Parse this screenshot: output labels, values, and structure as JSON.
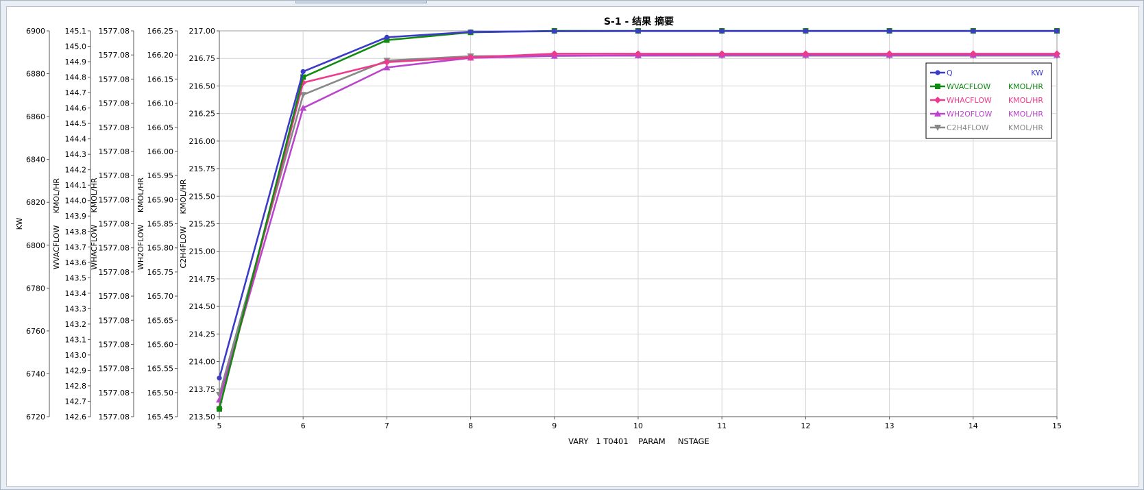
{
  "chart_data": {
    "type": "line",
    "title": "S-1 - 结果 摘要",
    "xlabel": "VARY   1 T0401    PARAM     NSTAGE",
    "x": [
      5,
      6,
      7,
      8,
      9,
      10,
      11,
      12,
      13,
      14,
      15
    ],
    "xlim": [
      5,
      15
    ],
    "grid": true,
    "legend_position": "top-right",
    "axes": [
      {
        "id": "q",
        "label": "KW",
        "ylim": [
          6720,
          6900
        ],
        "ticks": [
          "6720",
          "6740",
          "6760",
          "6780",
          "6800",
          "6820",
          "6840",
          "6860",
          "6880",
          "6900"
        ]
      },
      {
        "id": "wvac",
        "label": "WVACFLOW     KMOL/HR",
        "ylim": [
          142.6,
          145.1
        ],
        "ticks": [
          "142.6",
          "142.7",
          "142.8",
          "142.9",
          "143.0",
          "143.1",
          "143.2",
          "143.3",
          "143.4",
          "143.5",
          "143.6",
          "143.7",
          "143.8",
          "143.9",
          "144.0",
          "144.1",
          "144.2",
          "144.3",
          "144.4",
          "144.5",
          "144.6",
          "144.7",
          "144.8",
          "144.9",
          "145.0",
          "145.1"
        ]
      },
      {
        "id": "whac",
        "label": "WHACFLOW     KMOL/HR",
        "ylim": [
          0,
          16
        ],
        "ticks": [
          "1577.08",
          "1577.08",
          "1577.08",
          "1577.08",
          "1577.08",
          "1577.08",
          "1577.08",
          "1577.08",
          "1577.08",
          "1577.08",
          "1577.08",
          "1577.08",
          "1577.08",
          "1577.08",
          "1577.08",
          "1577.08",
          "1577.08"
        ]
      },
      {
        "id": "wh2o",
        "label": "WH2OFLOW     KMOL/HR",
        "ylim": [
          165.45,
          166.25
        ],
        "ticks": [
          "165.45",
          "165.50",
          "165.55",
          "165.60",
          "165.65",
          "165.70",
          "165.75",
          "165.80",
          "165.85",
          "165.90",
          "165.95",
          "166.00",
          "166.05",
          "166.10",
          "166.15",
          "166.20",
          "166.25"
        ]
      },
      {
        "id": "c2h4",
        "label": "C2H4FLOW     KMOL/HR",
        "ylim": [
          213.5,
          217.0
        ],
        "ticks": [
          "213.50",
          "213.75",
          "214.00",
          "214.25",
          "214.50",
          "214.75",
          "215.00",
          "215.25",
          "215.50",
          "215.75",
          "216.00",
          "216.25",
          "216.50",
          "216.75",
          "217.00"
        ]
      }
    ],
    "series": [
      {
        "name": "Q",
        "unit": "KW",
        "axis": "q",
        "color": "#3b3bc8",
        "marker": "circle",
        "values": [
          6738,
          6881,
          6897,
          6899.5,
          6899.8,
          6899.9,
          6899.9,
          6899.9,
          6899.9,
          6899.9,
          6899.9
        ]
      },
      {
        "name": "WVACFLOW",
        "unit": "KMOL/HR",
        "axis": "wvac",
        "color": "#118a11",
        "marker": "square",
        "values": [
          142.65,
          144.8,
          145.04,
          145.09,
          145.1,
          145.1,
          145.1,
          145.1,
          145.1,
          145.1,
          145.1
        ]
      },
      {
        "name": "WHACFLOW",
        "unit": "KMOL/HR",
        "axis": "whac",
        "color": "#ee3a8c",
        "marker": "diamond",
        "values": [
          0.35,
          13.85,
          14.7,
          14.9,
          15.05,
          15.05,
          15.05,
          15.05,
          15.05,
          15.05,
          15.05
        ]
      },
      {
        "name": "WH2OFLOW",
        "unit": "KMOL/HR",
        "axis": "wh2o",
        "color": "#bb44cc",
        "marker": "triangle-up",
        "values": [
          165.485,
          166.09,
          166.174,
          166.194,
          166.198,
          166.199,
          166.2,
          166.2,
          166.2,
          166.2,
          166.2
        ]
      },
      {
        "name": "C2H4FLOW",
        "unit": "KMOL/HR",
        "axis": "c2h4",
        "color": "#888888",
        "marker": "triangle-down",
        "values": [
          213.7,
          216.42,
          216.73,
          216.77,
          216.775,
          216.775,
          216.775,
          216.775,
          216.775,
          216.775,
          216.775
        ]
      }
    ]
  }
}
